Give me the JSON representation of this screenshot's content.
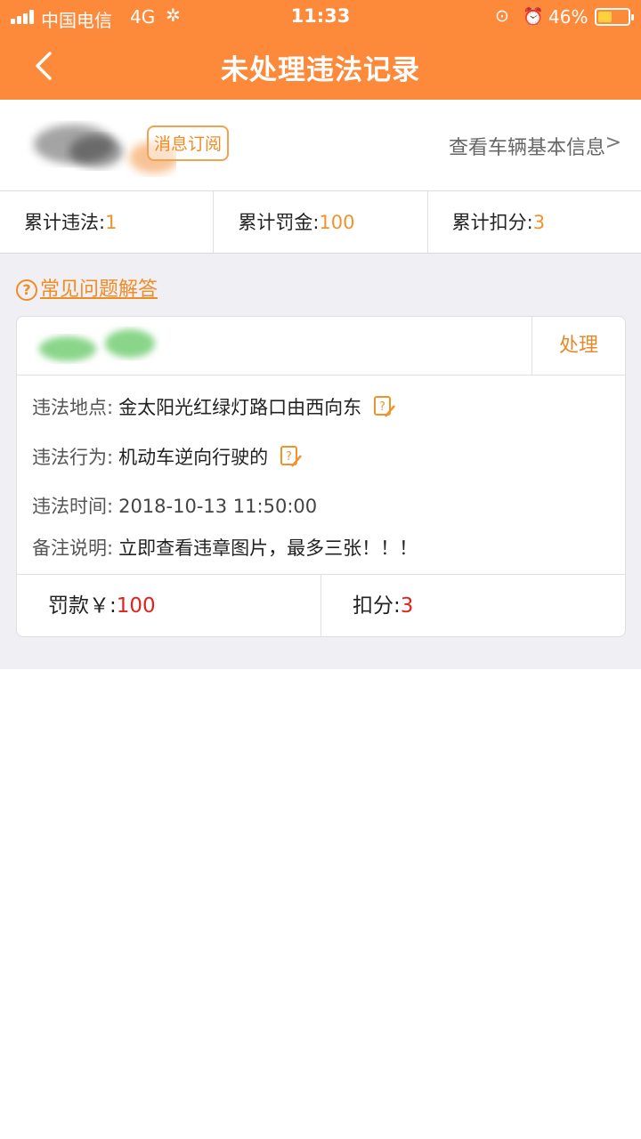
{
  "status_bar": {
    "carrier": "中国电信",
    "network": "4G",
    "time": "11:33",
    "battery_percent_label": "46%",
    "battery_level": 0.46,
    "signal_bars": 4
  },
  "header": {
    "title": "未处理违法记录",
    "background_color": "#fd8a3b"
  },
  "vehicle": {
    "subscribe_label": "消息订阅",
    "info_link": "查看车辆基本信息"
  },
  "summary": {
    "violations_label": "累计违法:",
    "violations_value": "1",
    "fines_label": "累计罚金:",
    "fines_value": "100",
    "points_label": "累计扣分:",
    "points_value": "3"
  },
  "faq_link": "常见问题解答",
  "record": {
    "action_label": "处理",
    "location_label": "违法地点:",
    "location_value": "金太阳光红绿灯路口由西向东",
    "behavior_label": "违法行为:",
    "behavior_value": "机动车逆向行驶的",
    "time_label": "违法时间:",
    "time_value": "2018-10-13 11:50:00",
    "note_label": "备注说明:",
    "note_value": "立即查看违章图片，最多三张！！！",
    "fine_label": "罚款￥:",
    "fine_value": "100",
    "points_label": "扣分:",
    "points_value": "3"
  },
  "colors": {
    "accent": "#f0932b",
    "alert": "#e0231c",
    "page_gray": "#f0eff4"
  }
}
